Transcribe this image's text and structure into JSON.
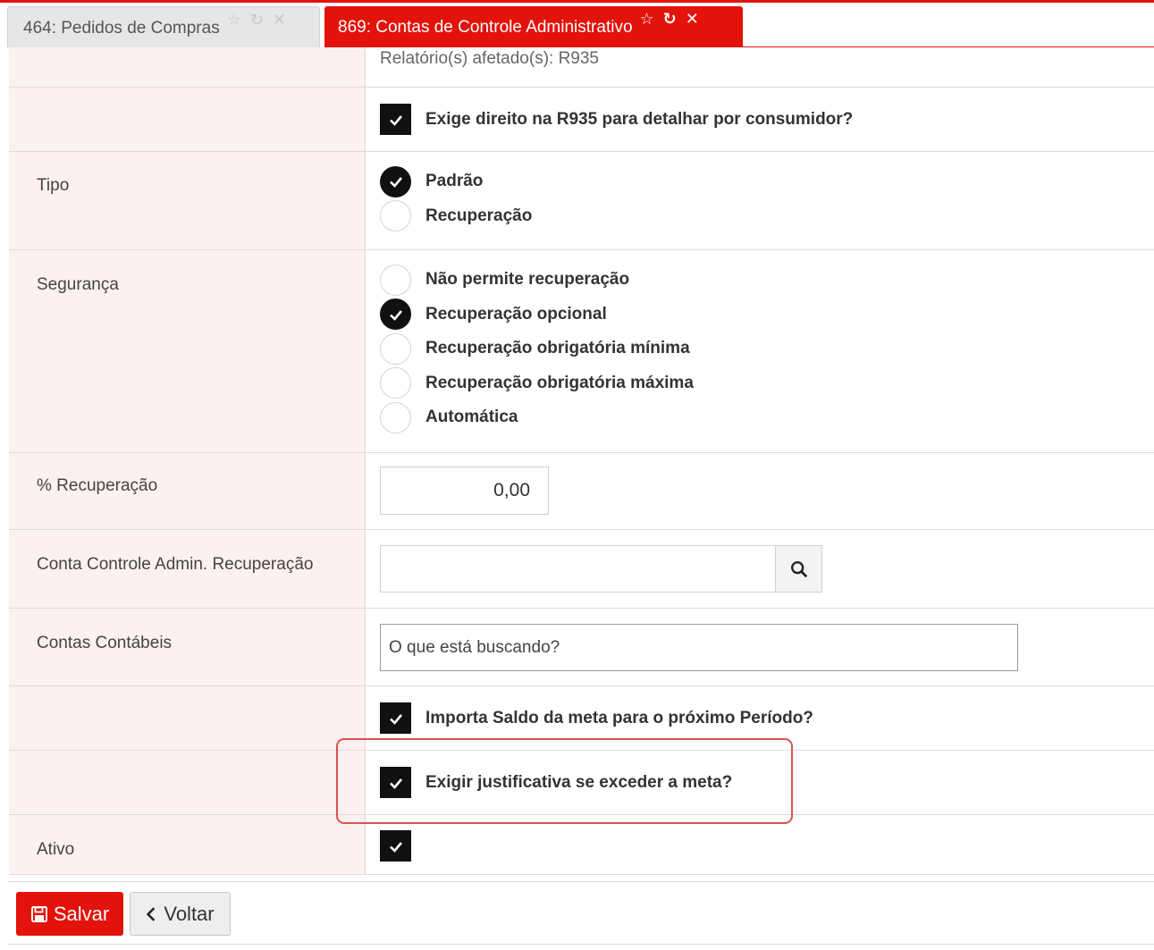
{
  "tabs": [
    {
      "label": "464: Pedidos de Compras",
      "active": false
    },
    {
      "label": "869: Contas de Controle Administrativo",
      "active": true
    }
  ],
  "tab_icons": [
    "star-icon",
    "refresh-icon",
    "close-icon"
  ],
  "form": {
    "affected_reports": "Relatório(s) afetado(s): R935",
    "detail_consumer_label": "Exige direito na R935 para detalhar por consumidor?",
    "detail_consumer_checked": true,
    "tipo": {
      "label": "Tipo",
      "options": [
        "Padrão",
        "Recuperação"
      ],
      "selected": "Padrão"
    },
    "seguranca": {
      "label": "Segurança",
      "options": [
        "Não permite recuperação",
        "Recuperação opcional",
        "Recuperação obrigatória mínima",
        "Recuperação obrigatória máxima",
        "Automática"
      ],
      "selected": "Recuperação opcional"
    },
    "recuperacao_pct": {
      "label": "% Recuperação",
      "value": "0,00"
    },
    "conta_recuperacao": {
      "label": "Conta Controle Admin. Recuperação",
      "value": ""
    },
    "contas_contabeis": {
      "label": "Contas Contábeis",
      "placeholder": "O que está buscando?"
    },
    "importa_saldo": {
      "label": "Importa Saldo da meta para o próximo Período?",
      "checked": true
    },
    "exigir_justificativa": {
      "label": "Exigir justificativa se exceder a meta?",
      "checked": true
    },
    "ativo": {
      "label": "Ativo",
      "checked": true
    }
  },
  "footer": {
    "save_label": "Salvar",
    "back_label": "Voltar"
  },
  "colors": {
    "accent": "#e3120b",
    "label_bg": "#fdf0f0",
    "highlight": "#d9534f"
  }
}
